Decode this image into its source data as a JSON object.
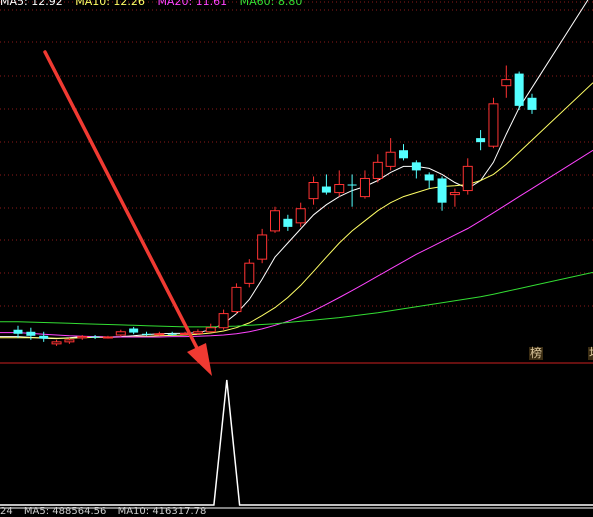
{
  "ma_legend": {
    "ma5": {
      "label": "MA5: 12.92",
      "color": "#ffffff"
    },
    "ma10": {
      "label": "MA10: 12.26",
      "color": "#ffff66"
    },
    "ma20": {
      "label": "MA20: 11.61",
      "color": "#ff44ff"
    },
    "ma60": {
      "label": "MA60: 8.80",
      "color": "#33dd33"
    }
  },
  "badges": {
    "left": "榜",
    "right": "地"
  },
  "volume_legend": {
    "prefix": "24",
    "ma5": "MA5: 488564.56",
    "ma10": "MA10: 416317.78"
  },
  "colors": {
    "up": "#ff3333",
    "down": "#54ffff",
    "grid": "#8b1a1a",
    "divider": "#cc2020",
    "arrow": "#f03a32",
    "signal": "#ffffff"
  },
  "chart_data": [
    {
      "type": "candlestick",
      "title": "",
      "ylim": [
        5.8,
        14.6
      ],
      "grid": "horizontal dotted",
      "candles": [
        {
          "o": 6.55,
          "c": 6.45,
          "h": 6.65,
          "l": 6.35
        },
        {
          "o": 6.5,
          "c": 6.4,
          "h": 6.6,
          "l": 6.3
        },
        {
          "o": 6.4,
          "c": 6.33,
          "h": 6.5,
          "l": 6.25
        },
        {
          "o": 6.2,
          "c": 6.25,
          "h": 6.3,
          "l": 6.15
        },
        {
          "o": 6.25,
          "c": 6.3,
          "h": 6.35,
          "l": 6.2
        },
        {
          "o": 6.35,
          "c": 6.38,
          "h": 6.42,
          "l": 6.3
        },
        {
          "o": 6.38,
          "c": 6.36,
          "h": 6.42,
          "l": 6.32
        },
        {
          "o": 6.36,
          "c": 6.37,
          "h": 6.4,
          "l": 6.33
        },
        {
          "o": 6.42,
          "c": 6.5,
          "h": 6.55,
          "l": 6.38
        },
        {
          "o": 6.58,
          "c": 6.48,
          "h": 6.62,
          "l": 6.44
        },
        {
          "o": 6.45,
          "c": 6.44,
          "h": 6.5,
          "l": 6.4
        },
        {
          "o": 6.44,
          "c": 6.45,
          "h": 6.5,
          "l": 6.4
        },
        {
          "o": 6.45,
          "c": 6.44,
          "h": 6.5,
          "l": 6.41
        },
        {
          "o": 6.44,
          "c": 6.46,
          "h": 6.5,
          "l": 6.42
        },
        {
          "o": 6.46,
          "c": 6.5,
          "h": 6.56,
          "l": 6.43
        },
        {
          "o": 6.5,
          "c": 6.6,
          "h": 6.7,
          "l": 6.48
        },
        {
          "o": 6.6,
          "c": 6.95,
          "h": 7.05,
          "l": 6.55
        },
        {
          "o": 7.0,
          "c": 7.6,
          "h": 7.7,
          "l": 6.95
        },
        {
          "o": 7.7,
          "c": 8.2,
          "h": 8.3,
          "l": 7.6
        },
        {
          "o": 8.3,
          "c": 8.9,
          "h": 9.05,
          "l": 8.2
        },
        {
          "o": 9.0,
          "c": 9.5,
          "h": 9.6,
          "l": 8.95
        },
        {
          "o": 9.3,
          "c": 9.1,
          "h": 9.4,
          "l": 9.0
        },
        {
          "o": 9.2,
          "c": 9.55,
          "h": 9.7,
          "l": 9.1
        },
        {
          "o": 9.8,
          "c": 10.2,
          "h": 10.35,
          "l": 9.65
        },
        {
          "o": 10.1,
          "c": 9.95,
          "h": 10.4,
          "l": 9.9
        },
        {
          "o": 9.95,
          "c": 10.15,
          "h": 10.5,
          "l": 9.85
        },
        {
          "o": 10.15,
          "c": 10.14,
          "h": 10.4,
          "l": 9.6
        },
        {
          "o": 9.85,
          "c": 10.3,
          "h": 10.5,
          "l": 9.8
        },
        {
          "o": 10.3,
          "c": 10.7,
          "h": 10.9,
          "l": 10.2
        },
        {
          "o": 10.6,
          "c": 10.95,
          "h": 11.3,
          "l": 10.5
        },
        {
          "o": 11.0,
          "c": 10.8,
          "h": 11.15,
          "l": 10.75
        },
        {
          "o": 10.7,
          "c": 10.5,
          "h": 10.75,
          "l": 10.3
        },
        {
          "o": 10.4,
          "c": 10.25,
          "h": 10.45,
          "l": 10.05
        },
        {
          "o": 10.3,
          "c": 9.7,
          "h": 10.35,
          "l": 9.5
        },
        {
          "o": 9.9,
          "c": 9.95,
          "h": 10.05,
          "l": 9.6
        },
        {
          "o": 10.0,
          "c": 10.6,
          "h": 10.8,
          "l": 9.9
        },
        {
          "o": 11.3,
          "c": 11.2,
          "h": 11.5,
          "l": 11.0
        },
        {
          "o": 11.1,
          "c": 12.15,
          "h": 12.3,
          "l": 11.05
        },
        {
          "o": 12.6,
          "c": 12.75,
          "h": 13.1,
          "l": 12.3
        },
        {
          "o": 12.9,
          "c": 12.1,
          "h": 12.95,
          "l": 12.0
        },
        {
          "o": 12.3,
          "c": 12.0,
          "h": 12.4,
          "l": 11.9
        }
      ],
      "ma_lines": [
        {
          "name": "MA5",
          "color": "#ffffff",
          "values": [
            6.38,
            6.36,
            6.34,
            6.33,
            6.35,
            6.38,
            6.38,
            6.37,
            6.38,
            6.4,
            6.43,
            6.45,
            6.46,
            6.46,
            6.48,
            6.55,
            6.7,
            6.95,
            7.3,
            7.8,
            8.35,
            8.7,
            9.05,
            9.4,
            9.65,
            9.85,
            10.0,
            10.1,
            10.25,
            10.45,
            10.6,
            10.6,
            10.55,
            10.4,
            10.2,
            10.05,
            10.25,
            10.7,
            11.4,
            12.05,
            12.55
          ]
        },
        {
          "name": "MA10",
          "color": "#ffff66",
          "values": [
            6.35,
            6.35,
            6.35,
            6.34,
            6.34,
            6.35,
            6.36,
            6.36,
            6.37,
            6.38,
            6.39,
            6.4,
            6.41,
            6.42,
            6.44,
            6.47,
            6.52,
            6.6,
            6.72,
            6.9,
            7.1,
            7.35,
            7.65,
            8.0,
            8.35,
            8.7,
            9.0,
            9.25,
            9.5,
            9.7,
            9.85,
            9.95,
            10.05,
            10.1,
            10.12,
            10.15,
            10.25,
            10.4,
            10.65,
            10.95,
            11.25
          ]
        },
        {
          "name": "MA20",
          "color": "#ff44ff",
          "values": [
            6.48,
            6.46,
            6.44,
            6.42,
            6.4,
            6.39,
            6.38,
            6.37,
            6.37,
            6.37,
            6.37,
            6.37,
            6.38,
            6.38,
            6.39,
            6.4,
            6.42,
            6.45,
            6.5,
            6.57,
            6.66,
            6.76,
            6.88,
            7.02,
            7.18,
            7.35,
            7.52,
            7.7,
            7.88,
            8.06,
            8.24,
            8.42,
            8.58,
            8.74,
            8.9,
            9.06,
            9.25,
            9.45,
            9.65,
            9.85,
            10.05
          ]
        },
        {
          "name": "MA60",
          "color": "#33dd33",
          "values": [
            6.75,
            6.74,
            6.73,
            6.72,
            6.71,
            6.7,
            6.69,
            6.68,
            6.67,
            6.66,
            6.65,
            6.64,
            6.63,
            6.62,
            6.62,
            6.62,
            6.63,
            6.64,
            6.66,
            6.68,
            6.7,
            6.73,
            6.76,
            6.79,
            6.82,
            6.85,
            6.89,
            6.93,
            6.97,
            7.02,
            7.07,
            7.12,
            7.17,
            7.22,
            7.27,
            7.32,
            7.37,
            7.43,
            7.5,
            7.57,
            7.64
          ]
        }
      ]
    },
    {
      "type": "line",
      "title": "",
      "ylim": [
        0,
        1
      ],
      "x": [
        0,
        1,
        2,
        3,
        4,
        5,
        6,
        7,
        8,
        9,
        10,
        11,
        12,
        13,
        14,
        15,
        16,
        17,
        18,
        19,
        20,
        21,
        22,
        23,
        24,
        25,
        26,
        27,
        28,
        29,
        30,
        31,
        32,
        33,
        34,
        35,
        36,
        37,
        38,
        39,
        40
      ],
      "values": [
        0,
        0,
        0,
        0,
        0,
        0,
        0,
        0,
        0,
        0,
        0,
        0,
        0,
        0,
        0,
        1,
        0,
        0,
        0,
        0,
        0,
        0,
        0,
        0,
        0,
        0,
        0,
        0,
        0,
        0,
        0,
        0,
        0,
        0,
        0,
        0,
        0,
        0,
        0,
        0,
        0
      ]
    }
  ]
}
